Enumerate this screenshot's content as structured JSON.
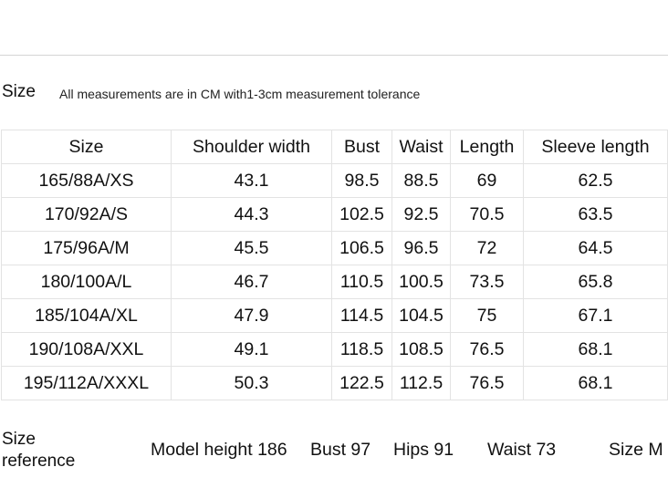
{
  "heading": "Size",
  "note": "All measurements are in CM with1-3cm measurement tolerance",
  "table": {
    "headers": [
      "Size",
      "Shoulder width",
      "Bust",
      "Waist",
      "Length",
      "Sleeve length"
    ],
    "rows": [
      [
        "165/88A/XS",
        "43.1",
        "98.5",
        "88.5",
        "69",
        "62.5"
      ],
      [
        "170/92A/S",
        "44.3",
        "102.5",
        "92.5",
        "70.5",
        "63.5"
      ],
      [
        "175/96A/M",
        "45.5",
        "106.5",
        "96.5",
        "72",
        "64.5"
      ],
      [
        "180/100A/L",
        "46.7",
        "110.5",
        "100.5",
        "73.5",
        "65.8"
      ],
      [
        "185/104A/XL",
        "47.9",
        "114.5",
        "104.5",
        "75",
        "67.1"
      ],
      [
        "190/108A/XXL",
        "49.1",
        "118.5",
        "108.5",
        "76.5",
        "68.1"
      ],
      [
        "195/112A/XXXL",
        "50.3",
        "122.5",
        "112.5",
        "76.5",
        "68.1"
      ]
    ]
  },
  "reference": {
    "label_line1": "Size",
    "label_line2": "reference",
    "model_height": "Model height 186",
    "bust": "Bust 97",
    "hips": "Hips 91",
    "waist": "Waist 73",
    "size": "Size M"
  }
}
